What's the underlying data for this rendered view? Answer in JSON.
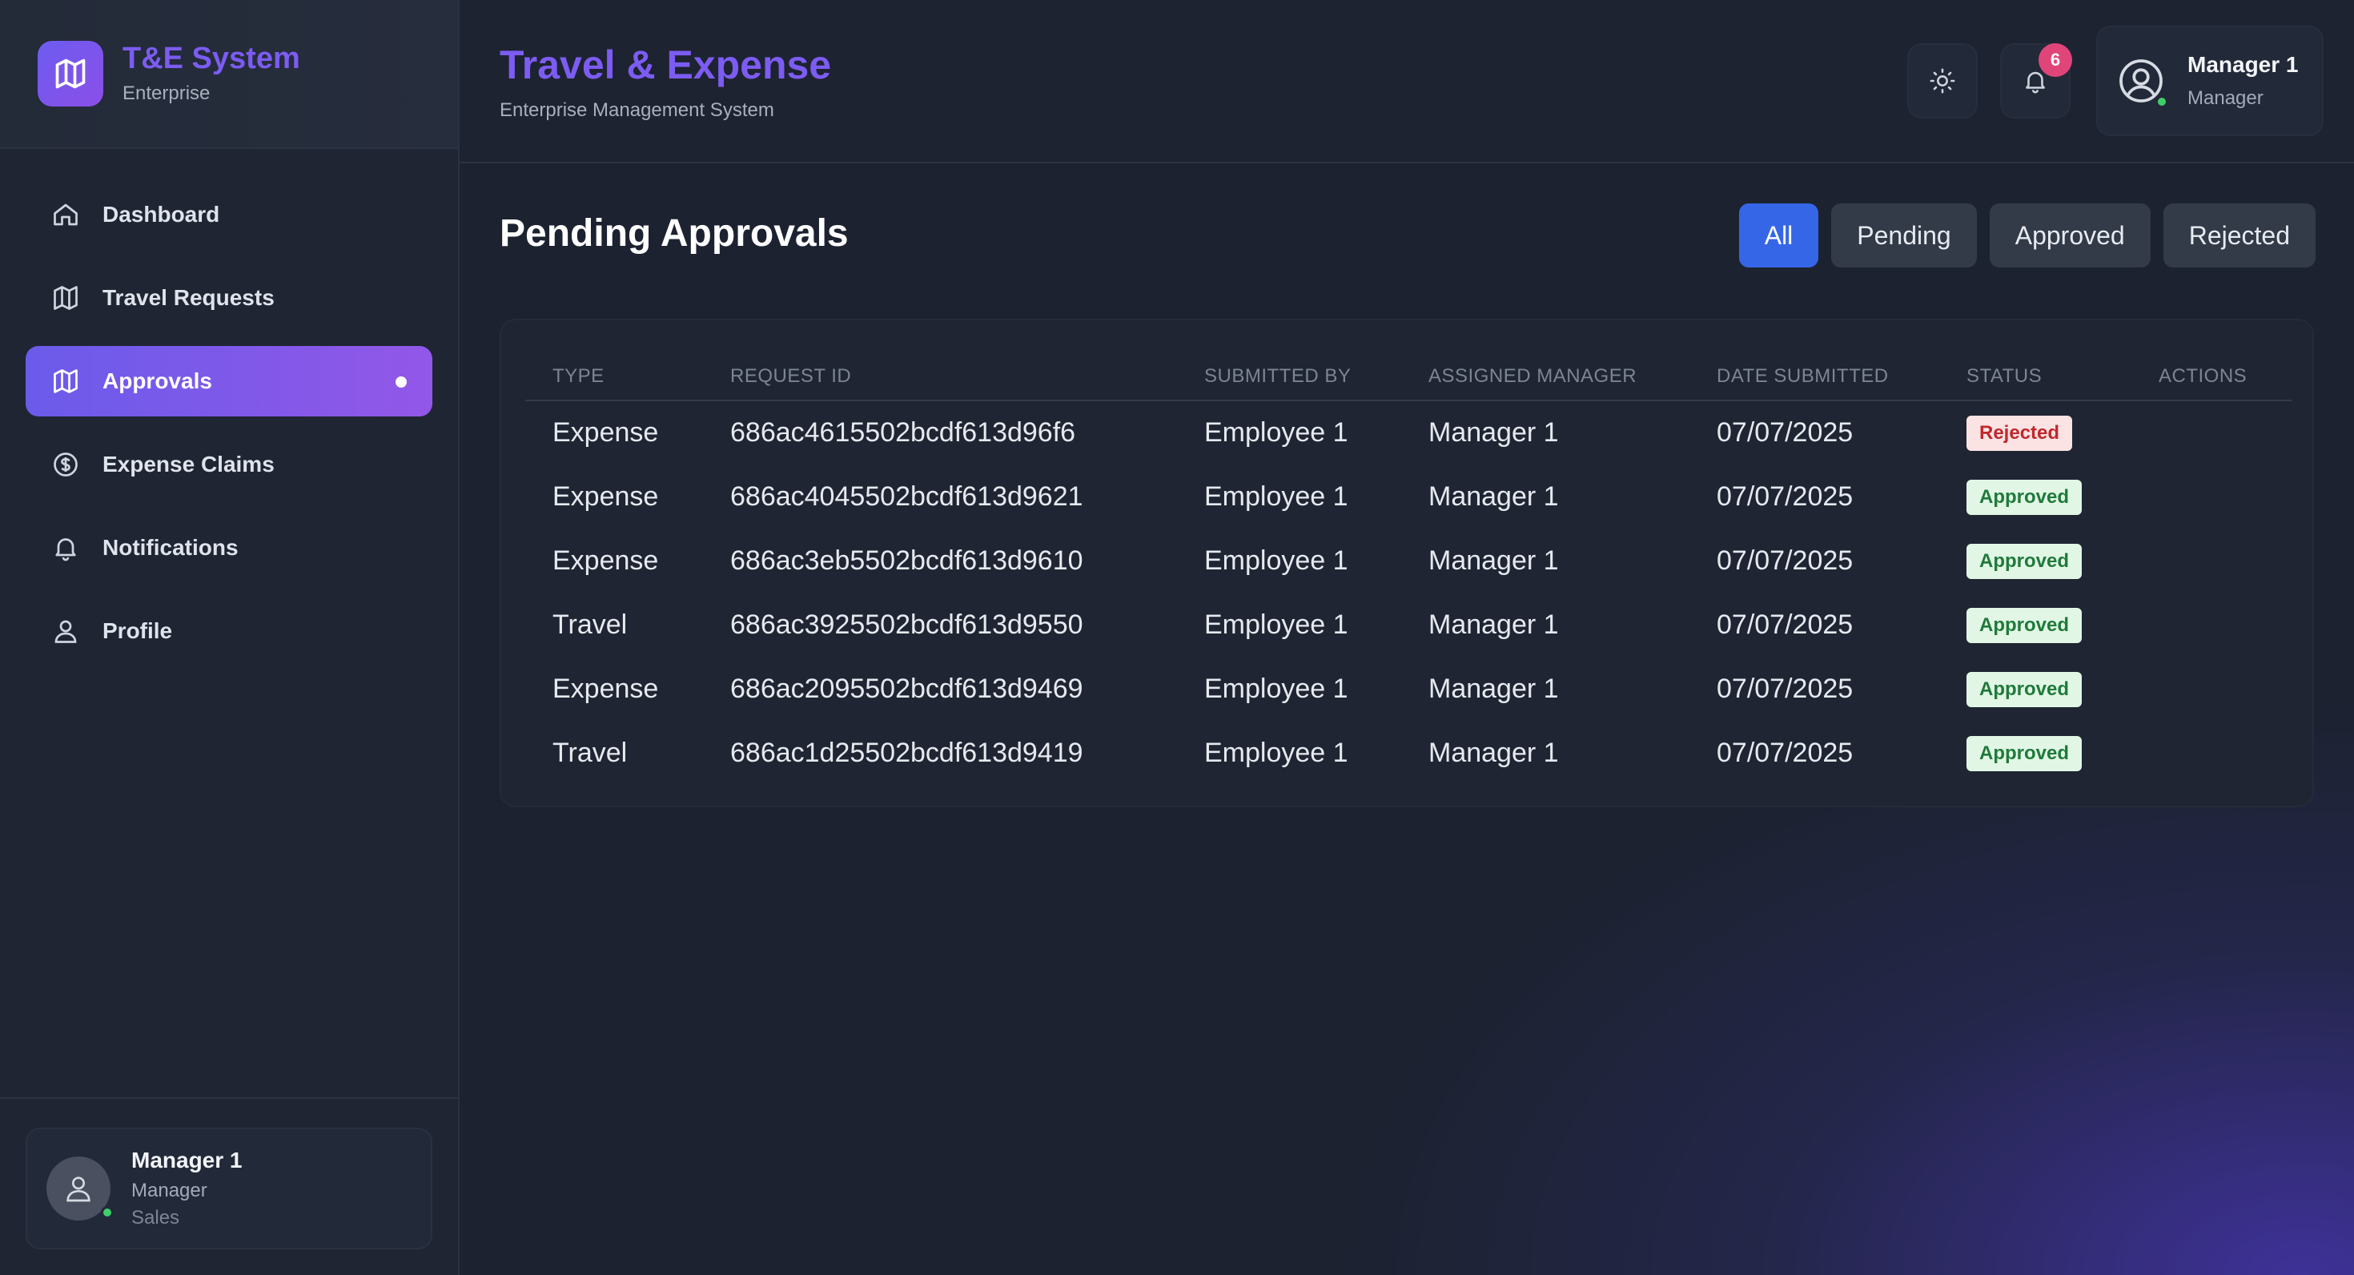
{
  "brand": {
    "title": "T&E System",
    "subtitle": "Enterprise"
  },
  "sidebar": {
    "items": [
      {
        "label": "Dashboard",
        "icon": "home-icon",
        "active": false
      },
      {
        "label": "Travel Requests",
        "icon": "map-icon",
        "active": false
      },
      {
        "label": "Approvals",
        "icon": "map-icon",
        "active": true
      },
      {
        "label": "Expense Claims",
        "icon": "dollar-circle-icon",
        "active": false
      },
      {
        "label": "Notifications",
        "icon": "bell-icon",
        "active": false
      },
      {
        "label": "Profile",
        "icon": "user-icon",
        "active": false
      }
    ],
    "user": {
      "name": "Manager 1",
      "role": "Manager",
      "department": "Sales"
    }
  },
  "header": {
    "title": "Travel & Expense",
    "subtitle": "Enterprise Management System",
    "notification_count": "6",
    "user": {
      "name": "Manager 1",
      "role": "Manager"
    }
  },
  "main": {
    "section_title": "Pending Approvals",
    "filters": [
      {
        "label": "All",
        "active": true
      },
      {
        "label": "Pending",
        "active": false
      },
      {
        "label": "Approved",
        "active": false
      },
      {
        "label": "Rejected",
        "active": false
      }
    ],
    "table": {
      "headers": [
        "TYPE",
        "REQUEST ID",
        "SUBMITTED BY",
        "ASSIGNED MANAGER",
        "DATE SUBMITTED",
        "STATUS",
        "ACTIONS"
      ],
      "rows": [
        {
          "type": "Expense",
          "request_id": "686ac4615502bcdf613d96f6",
          "submitted_by": "Employee 1",
          "manager": "Manager 1",
          "date": "07/07/2025",
          "status": "Rejected"
        },
        {
          "type": "Expense",
          "request_id": "686ac4045502bcdf613d9621",
          "submitted_by": "Employee 1",
          "manager": "Manager 1",
          "date": "07/07/2025",
          "status": "Approved"
        },
        {
          "type": "Expense",
          "request_id": "686ac3eb5502bcdf613d9610",
          "submitted_by": "Employee 1",
          "manager": "Manager 1",
          "date": "07/07/2025",
          "status": "Approved"
        },
        {
          "type": "Travel",
          "request_id": "686ac3925502bcdf613d9550",
          "submitted_by": "Employee 1",
          "manager": "Manager 1",
          "date": "07/07/2025",
          "status": "Approved"
        },
        {
          "type": "Expense",
          "request_id": "686ac2095502bcdf613d9469",
          "submitted_by": "Employee 1",
          "manager": "Manager 1",
          "date": "07/07/2025",
          "status": "Approved"
        },
        {
          "type": "Travel",
          "request_id": "686ac1d25502bcdf613d9419",
          "submitted_by": "Employee 1",
          "manager": "Manager 1",
          "date": "07/07/2025",
          "status": "Approved"
        }
      ]
    }
  },
  "colors": {
    "accent": "#7c5cf2",
    "primary_button": "#3566e8",
    "rejected_bg": "#fbe3e3",
    "approved_bg": "#e2f6e6",
    "online": "#3fcf6a",
    "badge": "#e0457a"
  }
}
